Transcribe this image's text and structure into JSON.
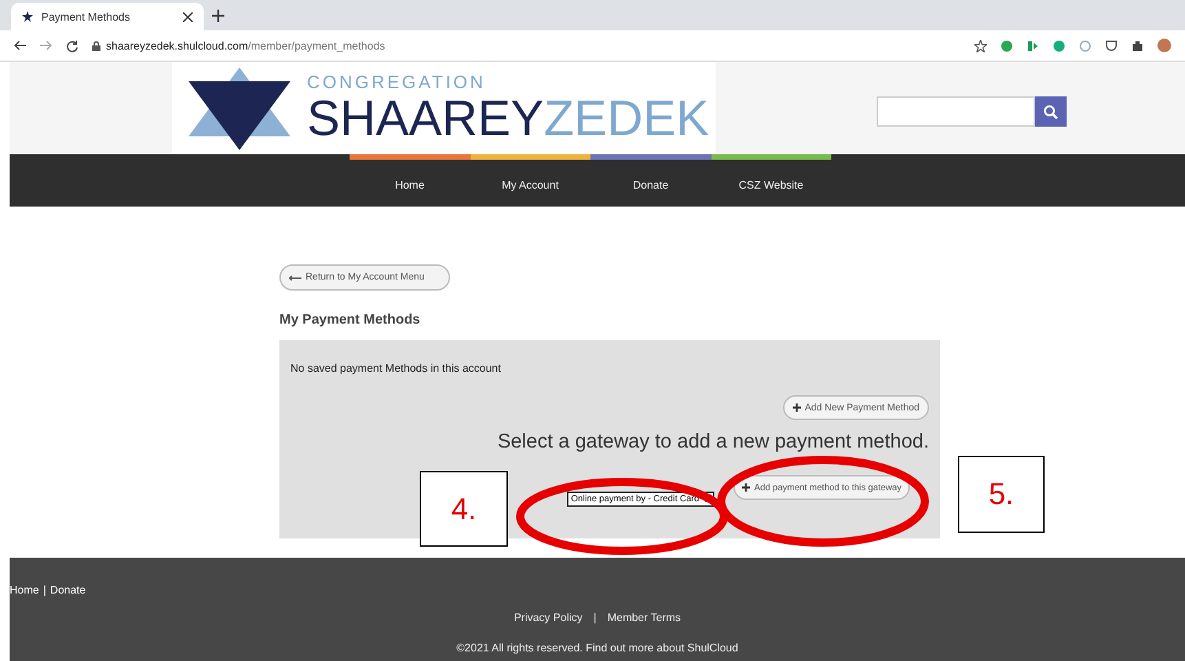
{
  "browser": {
    "tab_title": "Payment Methods",
    "url_domain": "shaareyzedek.shulcloud.com",
    "url_path": "/member/payment_methods"
  },
  "header": {
    "logo_top": "CONGREGATION",
    "logo_word_1": "SHAAREY",
    "logo_word_2": "ZEDEK"
  },
  "nav": [
    {
      "label": "Home",
      "color": "#e8773a"
    },
    {
      "label": "My Account",
      "color": "#f0b23e"
    },
    {
      "label": "Donate",
      "color": "#6b74b6"
    },
    {
      "label": "CSZ Website",
      "color": "#79bb4f"
    }
  ],
  "content": {
    "back_button": "Return to My Account Menu",
    "heading": "My Payment Methods",
    "empty_message": "No saved payment Methods in this account",
    "add_button": "Add New Payment Method",
    "gateway_prompt": "Select a gateway to add a new payment method.",
    "gateway_select": "Online payment by - Credit Card",
    "add_gateway_button": "Add payment method to this gateway"
  },
  "annotations": [
    {
      "label": "4."
    },
    {
      "label": "5."
    }
  ],
  "footer": {
    "quick_links": [
      "Home",
      "Donate"
    ],
    "quick_separator": "|",
    "links": [
      "Privacy Policy",
      "Member Terms"
    ],
    "separator": "|",
    "copyright": "©2021 All rights reserved. Find out more about ShulCloud"
  }
}
